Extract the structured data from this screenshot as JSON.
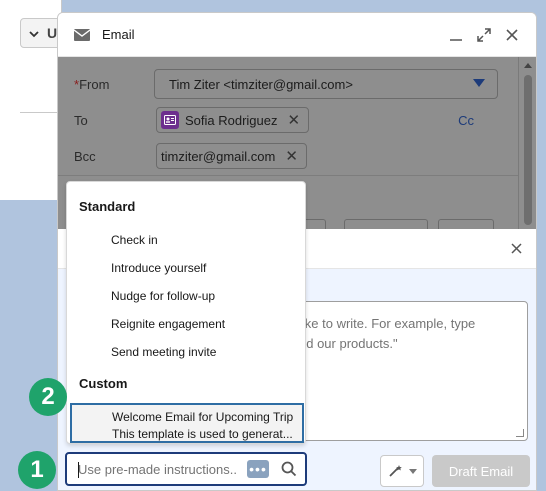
{
  "background": {
    "chip_label": "U"
  },
  "modal": {
    "title": "Email",
    "icon": "mail-icon",
    "controls": [
      "minimize-icon",
      "expand-icon",
      "close-icon"
    ]
  },
  "form": {
    "from_label": "From",
    "from_required_mark": "*",
    "from_value": "Tim Ziter <timziter@gmail.com>",
    "to_label": "To",
    "to_recipient": "Sofia Rodriguez",
    "cc_link": "Cc",
    "bcc_label": "Bcc",
    "bcc_recipient": "timziter@gmail.com"
  },
  "ai_panel": {
    "prompt_placeholder_line1": "like to write. For example, type",
    "prompt_placeholder_line2": "nd our products.\"",
    "draft_button": "Draft Email"
  },
  "dropdown": {
    "standard_heading": "Standard",
    "standard_items": [
      "Check in",
      "Introduce yourself",
      "Nudge for follow-up",
      "Reignite engagement",
      "Send meeting invite"
    ],
    "custom_heading": "Custom",
    "custom_item_title": "Welcome Email for Upcoming Trip",
    "custom_item_desc": "This template is used to generat..."
  },
  "search": {
    "placeholder": "Use pre-made instructions..."
  },
  "badges": {
    "one": "1",
    "two": "2"
  },
  "colors": {
    "badge": "#1fa36b",
    "focus": "#1d3b7a",
    "contact": "#6d2f8e"
  }
}
